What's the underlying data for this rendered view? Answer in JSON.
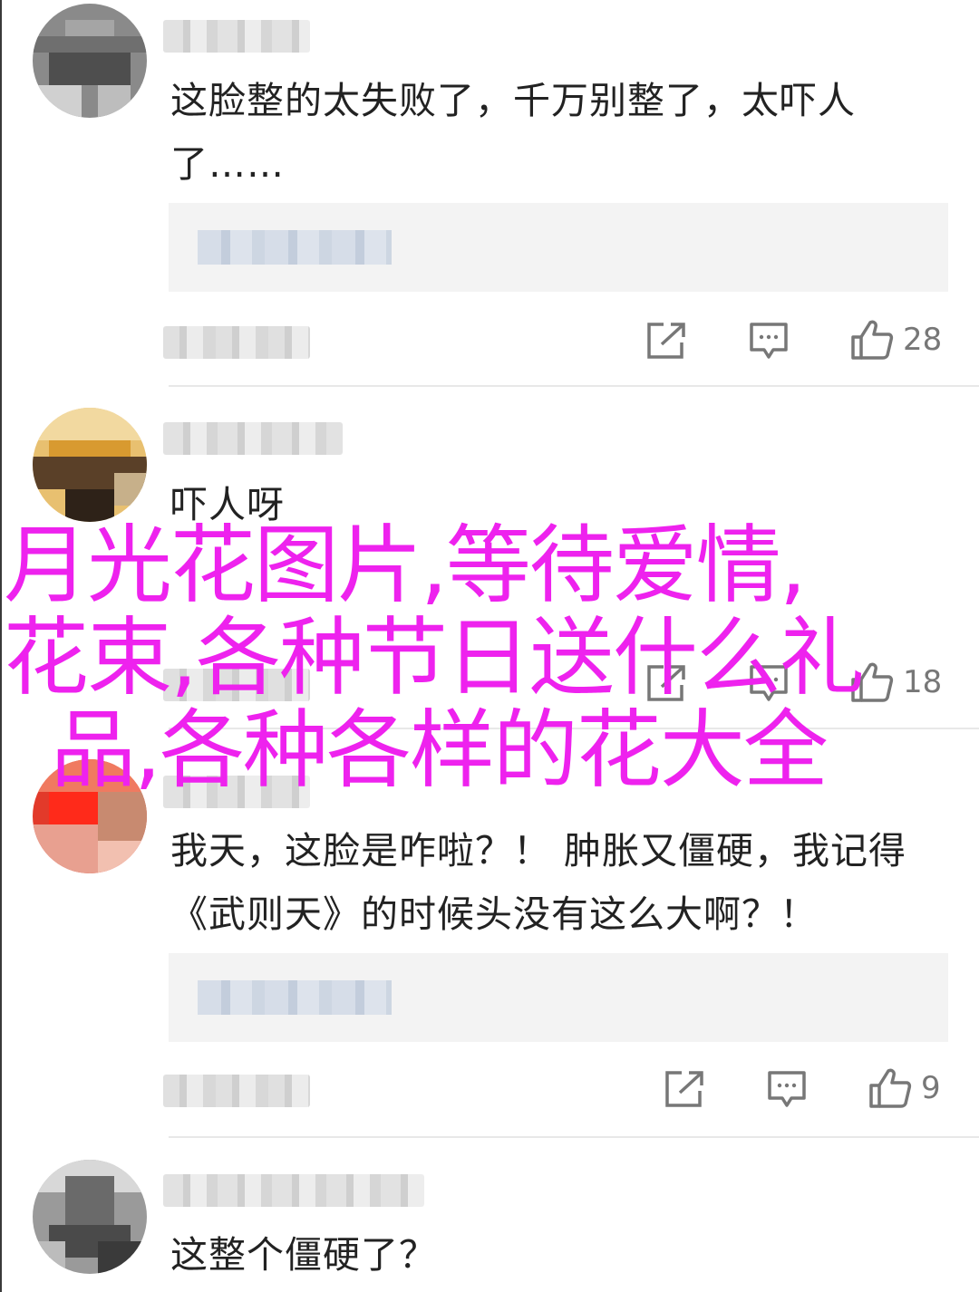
{
  "comments": [
    {
      "text": "这脸整的太失败了，千万别整了，太吓人了……",
      "likes": "28",
      "has_reply_preview": true
    },
    {
      "text": "吓人呀",
      "likes": "18",
      "has_reply_preview": false
    },
    {
      "text": "我天，这脸是咋啦？！ 肿胀又僵硬，我记得《武则天》的时候头没有这么大啊？！",
      "likes": "9",
      "has_reply_preview": true
    },
    {
      "text": "这整个僵硬了？",
      "likes": "",
      "has_reply_preview": false
    }
  ],
  "overlay": {
    "line1": "月光花图片,等待爱情,",
    "line2": "花束,各种节日送什么礼",
    "line3": "品,各种各样的花大全",
    "color": "#ee22ee"
  },
  "icons": {
    "share": "share-icon",
    "reply": "comment-icon",
    "like": "thumbs-up-icon"
  }
}
